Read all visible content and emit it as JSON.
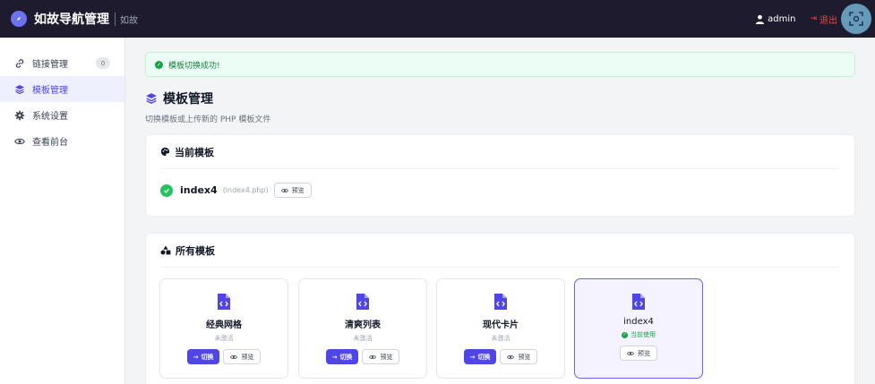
{
  "header": {
    "title": "如故导航管理",
    "subtitle": "如故",
    "user": "admin",
    "logout": "退出"
  },
  "sidebar": {
    "items": [
      {
        "label": "链接管理",
        "badge": "0",
        "icon": "link-icon"
      },
      {
        "label": "模板管理",
        "icon": "layers-icon",
        "active": true
      },
      {
        "label": "系统设置",
        "icon": "gear-icon"
      },
      {
        "label": "查看前台",
        "icon": "eye-icon"
      }
    ]
  },
  "alert": {
    "text": "模板切换成功!"
  },
  "page": {
    "title": "模板管理",
    "subtitle": "切换模板或上传新的 PHP 模板文件"
  },
  "current": {
    "heading": "当前模板",
    "name": "index4",
    "file": "(index4.php)",
    "preview": "预览"
  },
  "all": {
    "heading": "所有模板",
    "templates": [
      {
        "name": "经典网格",
        "status": "未激活",
        "switch": "切换",
        "preview": "预览"
      },
      {
        "name": "清爽列表",
        "status": "未激活",
        "switch": "切换",
        "preview": "预览"
      },
      {
        "name": "现代卡片",
        "status": "未激活",
        "switch": "切换",
        "preview": "预览"
      },
      {
        "name": "index4",
        "status": "当前使用",
        "preview": "预览"
      }
    ]
  },
  "colors": {
    "accent": "#4f46e5",
    "topbar": "#1e1b2e",
    "success": "#16a34a",
    "danger": "#ef4444"
  }
}
